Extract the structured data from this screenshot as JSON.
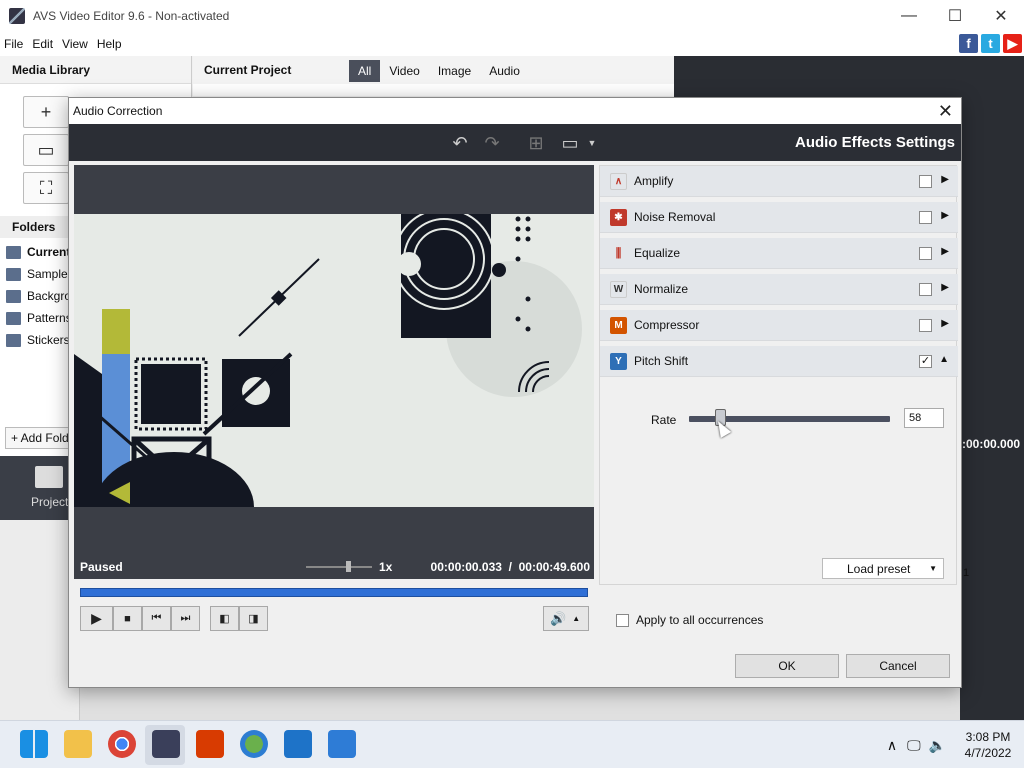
{
  "window": {
    "title": "AVS Video Editor 9.6 - Non-activated"
  },
  "menu": [
    "File",
    "Edit",
    "View",
    "Help"
  ],
  "social": {
    "facebook": "f",
    "twitter": "t",
    "youtube": "▶"
  },
  "library": {
    "title": "Media Library",
    "folders_title": "Folders",
    "folders": [
      "Current",
      "Samples",
      "Backgrou",
      "Patterns",
      "Stickers"
    ],
    "add_folder": "+ Add Fold"
  },
  "project": {
    "title": "Current Project",
    "filters": [
      "All",
      "Video",
      "Image",
      "Audio"
    ]
  },
  "bottom": {
    "projects_label": "Projects",
    "timecode": ":00:00.000",
    "ruler_mark": "1"
  },
  "dialog": {
    "title": "Audio Correction",
    "heading": "Audio Effects Settings",
    "status": "Paused",
    "speed": "1x",
    "time": "00:00:00.033  /  00:00:49.600",
    "effects": [
      {
        "label": "Amplify",
        "checked": false,
        "icon_color": "#ffffff"
      },
      {
        "label": "Noise Removal",
        "checked": false,
        "icon_color": "#c0392b"
      },
      {
        "label": "Equalize",
        "checked": false,
        "icon_color": "#ffffff"
      },
      {
        "label": "Normalize",
        "checked": false,
        "icon_color": "#ffffff"
      },
      {
        "label": "Compressor",
        "checked": false,
        "icon_color": "#d35400"
      },
      {
        "label": "Pitch Shift",
        "checked": true,
        "icon_color": "#2e6fb6"
      }
    ],
    "pitch": {
      "rate_label": "Rate",
      "rate_value": "58"
    },
    "load_preset": "Load preset",
    "apply_all": "Apply to all occurrences",
    "ok": "OK",
    "cancel": "Cancel"
  },
  "clock": {
    "time": "3:08 PM",
    "date": "4/7/2022"
  }
}
